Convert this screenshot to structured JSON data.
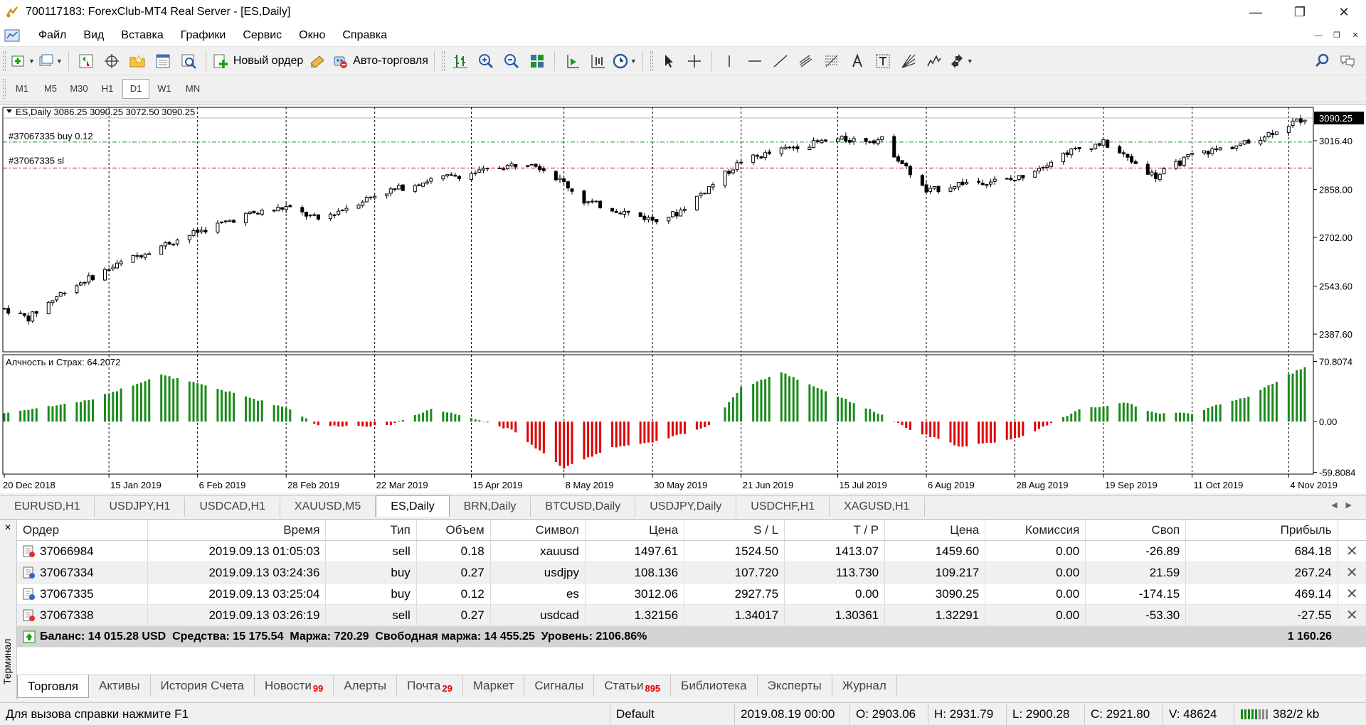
{
  "window": {
    "title": "700117183: ForexClub-MT4 Real Server - [ES,Daily]"
  },
  "menu": [
    "Файл",
    "Вид",
    "Вставка",
    "Графики",
    "Сервис",
    "Окно",
    "Справка"
  ],
  "toolbar": {
    "new_order_label": "Новый ордер",
    "autotrade_label": "Авто-торговля"
  },
  "timeframes": [
    "M1",
    "M5",
    "M30",
    "H1",
    "D1",
    "W1",
    "MN"
  ],
  "active_timeframe": "D1",
  "chart": {
    "header": "ES,Daily  3086.25 3090.25 3072.50 3090.25",
    "order_buy_label": "#37067335 buy 0.12",
    "order_sl_label": "#37067335 sl",
    "current_price_label": "3090.25",
    "price_ticks": [
      "3016.40",
      "2858.00",
      "2702.00",
      "2543.60",
      "2387.60"
    ],
    "indicator_label": "Алчность и Страх: 64.2072",
    "indicator_ticks": [
      "70.8074",
      "0.00",
      "-59.8084"
    ],
    "date_ticks": [
      "20 Dec 2018",
      "15 Jan 2019",
      "6 Feb 2019",
      "28 Feb 2019",
      "22 Mar 2019",
      "15 Apr 2019",
      "8 May 2019",
      "30 May 2019",
      "21 Jun 2019",
      "15 Jul 2019",
      "6 Aug 2019",
      "28 Aug 2019",
      "19 Sep 2019",
      "11 Oct 2019",
      "4 Nov 2019"
    ],
    "colors": {
      "bull": "#1a8a1a",
      "bear": "#e00000",
      "buy_line": "#1a8a1a",
      "sl_line": "#e00000"
    }
  },
  "chart_data": {
    "type": "candlestick",
    "symbol": "ES",
    "timeframe": "Daily",
    "close_path": [
      [
        "2018-12-20",
        2470
      ],
      [
        "2018-12-26",
        2440
      ],
      [
        "2019-01-04",
        2530
      ],
      [
        "2019-01-15",
        2600
      ],
      [
        "2019-01-25",
        2660
      ],
      [
        "2019-02-06",
        2720
      ],
      [
        "2019-02-18",
        2775
      ],
      [
        "2019-02-28",
        2800
      ],
      [
        "2019-03-08",
        2760
      ],
      [
        "2019-03-22",
        2840
      ],
      [
        "2019-04-05",
        2890
      ],
      [
        "2019-04-15",
        2910
      ],
      [
        "2019-04-30",
        2950
      ],
      [
        "2019-05-08",
        2880
      ],
      [
        "2019-05-13",
        2820
      ],
      [
        "2019-05-30",
        2760
      ],
      [
        "2019-06-05",
        2780
      ],
      [
        "2019-06-21",
        2950
      ],
      [
        "2019-07-05",
        3000
      ],
      [
        "2019-07-15",
        3020
      ],
      [
        "2019-07-26",
        3020
      ],
      [
        "2019-08-06",
        2850
      ],
      [
        "2019-08-15",
        2880
      ],
      [
        "2019-08-28",
        2890
      ],
      [
        "2019-09-10",
        2980
      ],
      [
        "2019-09-19",
        3010
      ],
      [
        "2019-10-02",
        2900
      ],
      [
        "2019-10-11",
        2970
      ],
      [
        "2019-10-25",
        3010
      ],
      [
        "2019-11-04",
        3070
      ],
      [
        "2019-11-08",
        3090
      ]
    ],
    "indicator": {
      "name": "Алчность и Страх",
      "last_value": 64.2072,
      "range": [
        -59.8084,
        70.8074
      ],
      "path": [
        [
          "2018-12-20",
          10
        ],
        [
          "2019-01-10",
          25
        ],
        [
          "2019-01-28",
          55
        ],
        [
          "2019-02-10",
          40
        ],
        [
          "2019-03-01",
          15
        ],
        [
          "2019-03-08",
          -5
        ],
        [
          "2019-03-25",
          -5
        ],
        [
          "2019-04-05",
          15
        ],
        [
          "2019-04-15",
          5
        ],
        [
          "2019-04-25",
          -10
        ],
        [
          "2019-05-08",
          -55
        ],
        [
          "2019-05-20",
          -30
        ],
        [
          "2019-05-30",
          -25
        ],
        [
          "2019-06-13",
          -5
        ],
        [
          "2019-06-21",
          40
        ],
        [
          "2019-07-01",
          58
        ],
        [
          "2019-07-10",
          40
        ],
        [
          "2019-07-25",
          10
        ],
        [
          "2019-08-02",
          -10
        ],
        [
          "2019-08-15",
          -30
        ],
        [
          "2019-08-28",
          -20
        ],
        [
          "2019-09-05",
          -5
        ],
        [
          "2019-09-13",
          15
        ],
        [
          "2019-09-25",
          22
        ],
        [
          "2019-10-02",
          10
        ],
        [
          "2019-10-11",
          10
        ],
        [
          "2019-10-25",
          30
        ],
        [
          "2019-11-04",
          55
        ],
        [
          "2019-11-08",
          65
        ]
      ]
    }
  },
  "chart_tabs": [
    "EURUSD,H1",
    "USDJPY,H1",
    "USDCAD,H1",
    "XAUUSD,M5",
    "ES,Daily",
    "BRN,Daily",
    "BTCUSD,Daily",
    "USDJPY,Daily",
    "USDCHF,H1",
    "XAGUSD,H1"
  ],
  "active_chart_tab": "ES,Daily",
  "terminal": {
    "side_label": "Терминал",
    "columns": [
      "Ордер",
      "Время",
      "Тип",
      "Объем",
      "Символ",
      "Цена",
      "S / L",
      "T / P",
      "Цена",
      "Комиссия",
      "Своп",
      "Прибыль"
    ],
    "rows": [
      {
        "order": "37066984",
        "time": "2019.09.13 01:05:03",
        "type": "sell",
        "volume": "0.18",
        "symbol": "xauusd",
        "price": "1497.61",
        "sl": "1524.50",
        "tp": "1413.07",
        "current": "1459.60",
        "commission": "0.00",
        "swap": "-26.89",
        "profit": "684.18"
      },
      {
        "order": "37067334",
        "time": "2019.09.13 03:24:36",
        "type": "buy",
        "volume": "0.27",
        "symbol": "usdjpy",
        "price": "108.136",
        "sl": "107.720",
        "tp": "113.730",
        "current": "109.217",
        "commission": "0.00",
        "swap": "21.59",
        "profit": "267.24"
      },
      {
        "order": "37067335",
        "time": "2019.09.13 03:25:04",
        "type": "buy",
        "volume": "0.12",
        "symbol": "es",
        "price": "3012.06",
        "sl": "2927.75",
        "tp": "0.00",
        "current": "3090.25",
        "commission": "0.00",
        "swap": "-174.15",
        "profit": "469.14"
      },
      {
        "order": "37067338",
        "time": "2019.09.13 03:26:19",
        "type": "sell",
        "volume": "0.27",
        "symbol": "usdcad",
        "price": "1.32156",
        "sl": "1.34017",
        "tp": "1.30361",
        "current": "1.32291",
        "commission": "0.00",
        "swap": "-53.30",
        "profit": "-27.55"
      }
    ],
    "summary": "Баланс: 14 015.28 USD  Средства: 15 175.54  Маржа: 720.29  Свободная маржа: 14 455.25  Уровень: 2106.86%",
    "summary_profit": "1 160.26",
    "tabs": [
      {
        "label": "Торговля",
        "badge": ""
      },
      {
        "label": "Активы",
        "badge": ""
      },
      {
        "label": "История Счета",
        "badge": ""
      },
      {
        "label": "Новости",
        "badge": "99"
      },
      {
        "label": "Алерты",
        "badge": ""
      },
      {
        "label": "Почта",
        "badge": "29"
      },
      {
        "label": "Маркет",
        "badge": ""
      },
      {
        "label": "Сигналы",
        "badge": ""
      },
      {
        "label": "Статьи",
        "badge": "895"
      },
      {
        "label": "Библиотека",
        "badge": ""
      },
      {
        "label": "Эксперты",
        "badge": ""
      },
      {
        "label": "Журнал",
        "badge": ""
      }
    ],
    "active_tab": "Торговля"
  },
  "status": {
    "help": "Для вызова справки нажмите F1",
    "profile": "Default",
    "datetime": "2019.08.19 00:00",
    "open": "O: 2903.06",
    "high": "H: 2931.79",
    "low": "L: 2900.28",
    "close": "C: 2921.80",
    "volume": "V: 48624",
    "traffic": "382/2 kb"
  }
}
